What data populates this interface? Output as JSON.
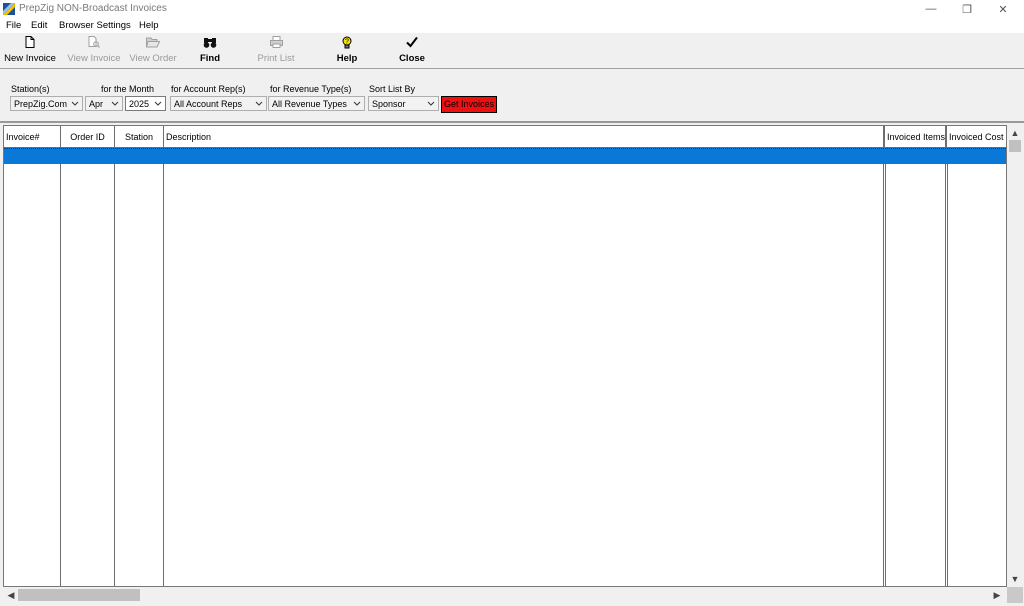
{
  "window": {
    "title": "PrepZig NON-Broadcast Invoices",
    "controls": {
      "minimize": "—",
      "restore": "❐",
      "close": "✕"
    }
  },
  "menu": [
    "File",
    "Edit",
    "Browser Settings",
    "Help"
  ],
  "toolbar": {
    "new_invoice": "New Invoice",
    "view_invoice": "View Invoice",
    "view_order": "View Order",
    "find": "Find",
    "print_list": "Print List",
    "help": "Help",
    "close": "Close"
  },
  "filters": {
    "stations_label": "Station(s)",
    "stations_value": "PrepZig.Com",
    "month_label": "for the Month",
    "month_value": "Apr",
    "year_value": "2025",
    "rep_label": "for Account Rep(s)",
    "rep_value": "All Account Reps",
    "revenue_label": "for Revenue Type(s)",
    "revenue_value": "All Revenue Types",
    "sort_label": "Sort List By",
    "sort_value": "Sponsor",
    "get_button": "Get Invoices"
  },
  "grid": {
    "columns": [
      "Invoice#",
      "Order ID",
      "Station",
      "Description",
      "Invoiced Items",
      "Invoiced Cost"
    ]
  },
  "colors": {
    "selection": "#0a78d7",
    "get_button": "#ee1010"
  }
}
